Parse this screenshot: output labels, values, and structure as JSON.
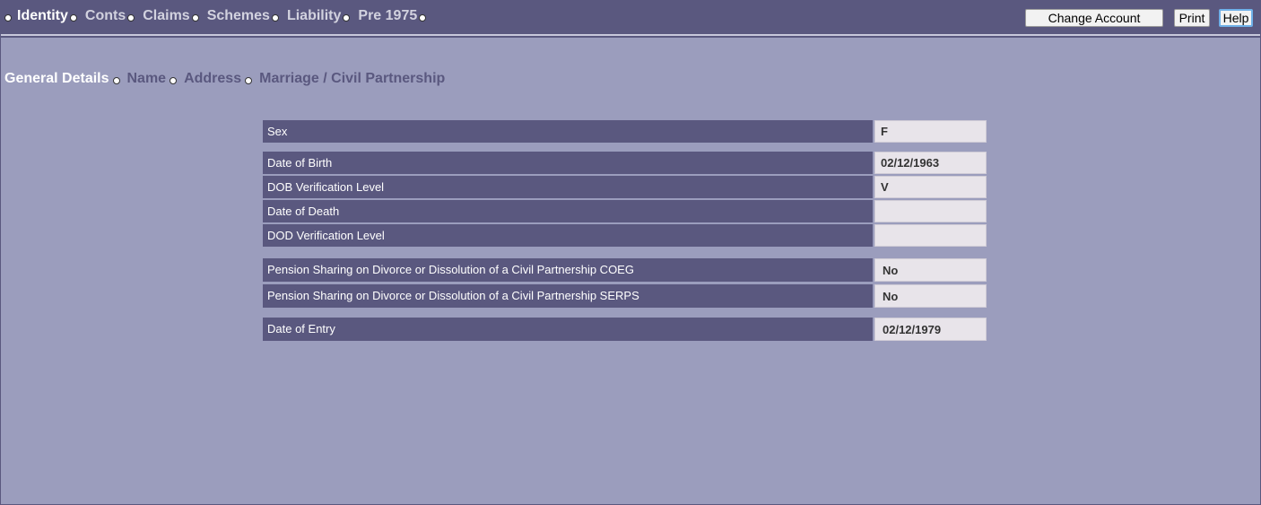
{
  "nav": {
    "items": [
      {
        "label": "Identity",
        "active": true
      },
      {
        "label": "Conts"
      },
      {
        "label": "Claims"
      },
      {
        "label": "Schemes"
      },
      {
        "label": "Liability"
      },
      {
        "label": "Pre 1975"
      }
    ]
  },
  "toolbar": {
    "change_account_label": "Change Account",
    "print_label": "Print",
    "help_label": "Help"
  },
  "subnav": {
    "items": [
      {
        "label": "General Details",
        "active": true
      },
      {
        "label": "Name"
      },
      {
        "label": "Address"
      },
      {
        "label": "Marriage / Civil Partnership"
      }
    ]
  },
  "fields": [
    {
      "label": "Sex",
      "value": "F"
    },
    {
      "label": "Date of Birth",
      "value": "02/12/1963"
    },
    {
      "label": "DOB Verification Level",
      "value": "V"
    },
    {
      "label": "Date of Death",
      "value": ""
    },
    {
      "label": "DOD Verification Level",
      "value": ""
    },
    {
      "label": "Pension Sharing on Divorce or Dissolution of a Civil Partnership COEG",
      "value": "No"
    },
    {
      "label": "Pension Sharing on Divorce or Dissolution of a Civil Partnership SERPS",
      "value": "No"
    },
    {
      "label": "Date of Entry",
      "value": "02/12/1979"
    }
  ],
  "colors": {
    "bar": "#5a587f",
    "background": "#9b9dbd",
    "value_box": "#e8e4ea"
  }
}
